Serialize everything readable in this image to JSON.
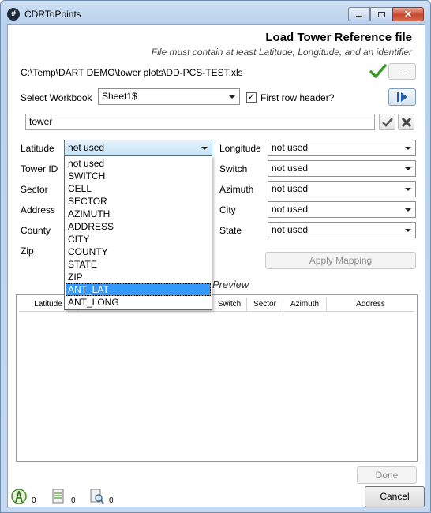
{
  "window": {
    "title": "CDRToPoints",
    "app_icon_glyph": "#"
  },
  "header": {
    "title": "Load Tower Reference file",
    "subtitle": "File must contain at least Latitude, Longitude, and an identifier"
  },
  "file": {
    "path": "C:\\Temp\\DART DEMO\\tower plots\\DD-PCS-TEST.xls",
    "browse_label": "..."
  },
  "workbook": {
    "label": "Select Workbook",
    "value": "Sheet1$",
    "first_row_header_label": "First row header?",
    "first_row_header_checked": true
  },
  "identifier_input": {
    "value": "tower"
  },
  "mappings": {
    "latitude": {
      "label": "Latitude",
      "value": "not used"
    },
    "tower_id": {
      "label": "Tower ID"
    },
    "sector": {
      "label": "Sector"
    },
    "address": {
      "label": "Address"
    },
    "county": {
      "label": "County"
    },
    "zip": {
      "label": "Zip"
    },
    "longitude": {
      "label": "Longitude",
      "value": "not used"
    },
    "switch": {
      "label": "Switch",
      "value": "not used"
    },
    "azimuth": {
      "label": "Azimuth",
      "value": "not used"
    },
    "city": {
      "label": "City",
      "value": "not used"
    },
    "state": {
      "label": "State",
      "value": "not used"
    }
  },
  "apply_label": "Apply Mapping",
  "preview": {
    "label": "Preview",
    "columns": [
      "Latitude",
      "Switch",
      "Sector",
      "Azimuth",
      "Address"
    ]
  },
  "dropdown_options": [
    "not used",
    "SWITCH",
    "CELL",
    "SECTOR",
    "AZIMUTH",
    "ADDRESS",
    "CITY",
    "COUNTY",
    "STATE",
    "ZIP",
    "ANT_LAT",
    "ANT_LONG"
  ],
  "dropdown_selected": "ANT_LAT",
  "buttons": {
    "done": "Done",
    "cancel": "Cancel"
  },
  "status": [
    {
      "icon": "tower-icon",
      "count": "0"
    },
    {
      "icon": "document-icon",
      "count": "0"
    },
    {
      "icon": "search-document-icon",
      "count": "0"
    }
  ],
  "colors": {
    "accent": "#3399ff",
    "check_green": "#3a9a2a",
    "close_red": "#c8452c"
  }
}
